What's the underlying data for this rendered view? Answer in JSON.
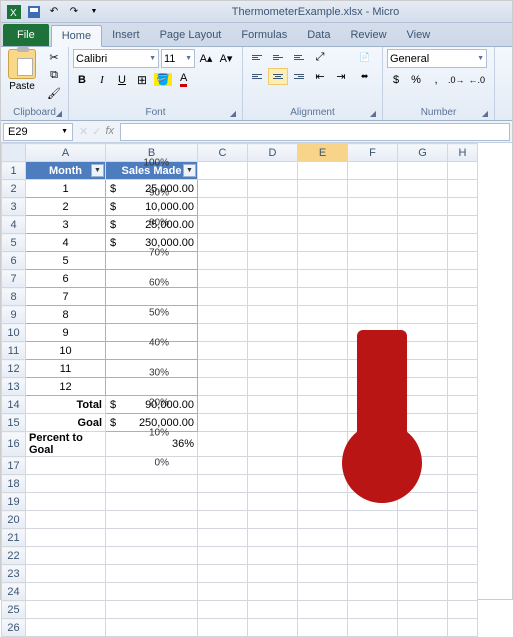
{
  "title": "ThermometerExample.xlsx - Micro",
  "tabs": {
    "file": "File",
    "home": "Home",
    "insert": "Insert",
    "pagelayout": "Page Layout",
    "formulas": "Formulas",
    "data": "Data",
    "review": "Review",
    "view": "View"
  },
  "ribbon": {
    "clipboard": {
      "paste": "Paste",
      "label": "Clipboard"
    },
    "font": {
      "family": "Calibri",
      "size": "11",
      "label": "Font"
    },
    "alignment": {
      "label": "Alignment"
    },
    "number": {
      "format": "General",
      "label": "Number"
    }
  },
  "namebox": "E29",
  "columns": [
    "A",
    "B",
    "C",
    "D",
    "E",
    "F",
    "G",
    "H"
  ],
  "headers": {
    "month": "Month",
    "sales": "Sales Made"
  },
  "rows": [
    {
      "m": "1",
      "s": "25,000.00"
    },
    {
      "m": "2",
      "s": "10,000.00"
    },
    {
      "m": "3",
      "s": "25,000.00"
    },
    {
      "m": "4",
      "s": "30,000.00"
    },
    {
      "m": "5",
      "s": ""
    },
    {
      "m": "6",
      "s": ""
    },
    {
      "m": "7",
      "s": ""
    },
    {
      "m": "8",
      "s": ""
    },
    {
      "m": "9",
      "s": ""
    },
    {
      "m": "10",
      "s": ""
    },
    {
      "m": "11",
      "s": ""
    },
    {
      "m": "12",
      "s": ""
    }
  ],
  "summary": {
    "total_label": "Total",
    "total": "90,000.00",
    "goal_label": "Goal",
    "goal": "250,000.00",
    "pct_label": "Percent to Goal",
    "pct": "36%"
  },
  "currency": "$",
  "chart_data": {
    "type": "bar",
    "title": "",
    "categories": [
      "Percent to Goal"
    ],
    "values": [
      36
    ],
    "ylabel": "",
    "xlabel": "",
    "ylim": [
      0,
      100
    ],
    "ticks": [
      "100%",
      "90%",
      "80%",
      "70%",
      "60%",
      "50%",
      "40%",
      "30%",
      "20%",
      "10%",
      "0%"
    ]
  }
}
